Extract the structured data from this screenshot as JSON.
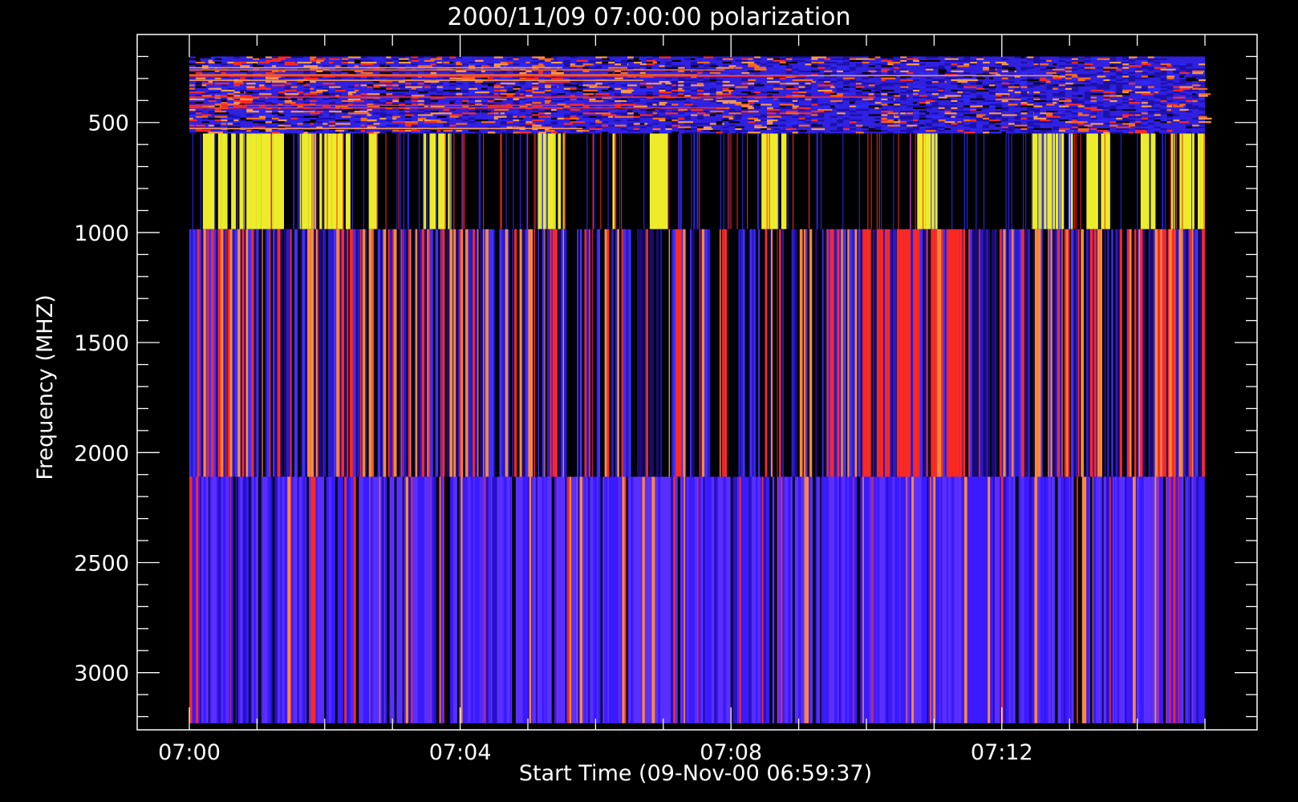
{
  "chart_data": {
    "type": "heatmap",
    "title": "2000/11/09 07:00:00 polarization",
    "xlabel": "Start Time (09-Nov-00 06:59:37)",
    "ylabel": "Frequency (MHZ)",
    "x_ticks": [
      "07:00",
      "07:04",
      "07:08",
      "07:12"
    ],
    "x_tick_minutes": [
      0,
      4,
      8,
      12
    ],
    "y_ticks": [
      500,
      1000,
      1500,
      2000,
      2500,
      3000
    ],
    "y_range": [
      100,
      3260
    ],
    "x_range_minutes": [
      -0.77,
      15.77
    ],
    "data_span_minutes": [
      0,
      15
    ],
    "grid": false,
    "bands": [
      {
        "freq_range": [
          200,
          550
        ],
        "pattern": "fine-noise",
        "palette": [
          "#3020e0",
          "#1c10a8",
          "#ff6a1a",
          "#ff2a20",
          "#ff9a4a",
          "#0a0000",
          "#2a2aff"
        ]
      },
      {
        "freq_range": [
          550,
          985
        ],
        "pattern": "yellow-blocks",
        "palette": [
          "#000000",
          "#ecec2a",
          "#2a2aff",
          "#ff2a20"
        ]
      },
      {
        "freq_range": [
          985,
          2110
        ],
        "pattern": "vertical-stripes",
        "palette": [
          "#2a1acc",
          "#000000",
          "#ff2a20",
          "#4030ff",
          "#ff8a3a",
          "#1a0a70"
        ]
      },
      {
        "freq_range": [
          2110,
          3230
        ],
        "pattern": "vertical-stripes",
        "palette": [
          "#3a1aff",
          "#5a30ff",
          "#ff8a3a",
          "#ff2a20",
          "#2a10c0",
          "#000000"
        ]
      }
    ],
    "yellow_block_ranges_minutes": [
      [
        0.2,
        1.4
      ],
      [
        1.63,
        2.38
      ],
      [
        2.65,
        2.78
      ],
      [
        3.45,
        3.87
      ],
      [
        5.15,
        5.55
      ],
      [
        6.25,
        6.32
      ],
      [
        6.8,
        7.07
      ],
      [
        8.45,
        8.82
      ],
      [
        10.75,
        11.05
      ],
      [
        12.45,
        13.05
      ],
      [
        13.25,
        13.6
      ],
      [
        14.05,
        14.27
      ],
      [
        14.5,
        15
      ]
    ]
  }
}
